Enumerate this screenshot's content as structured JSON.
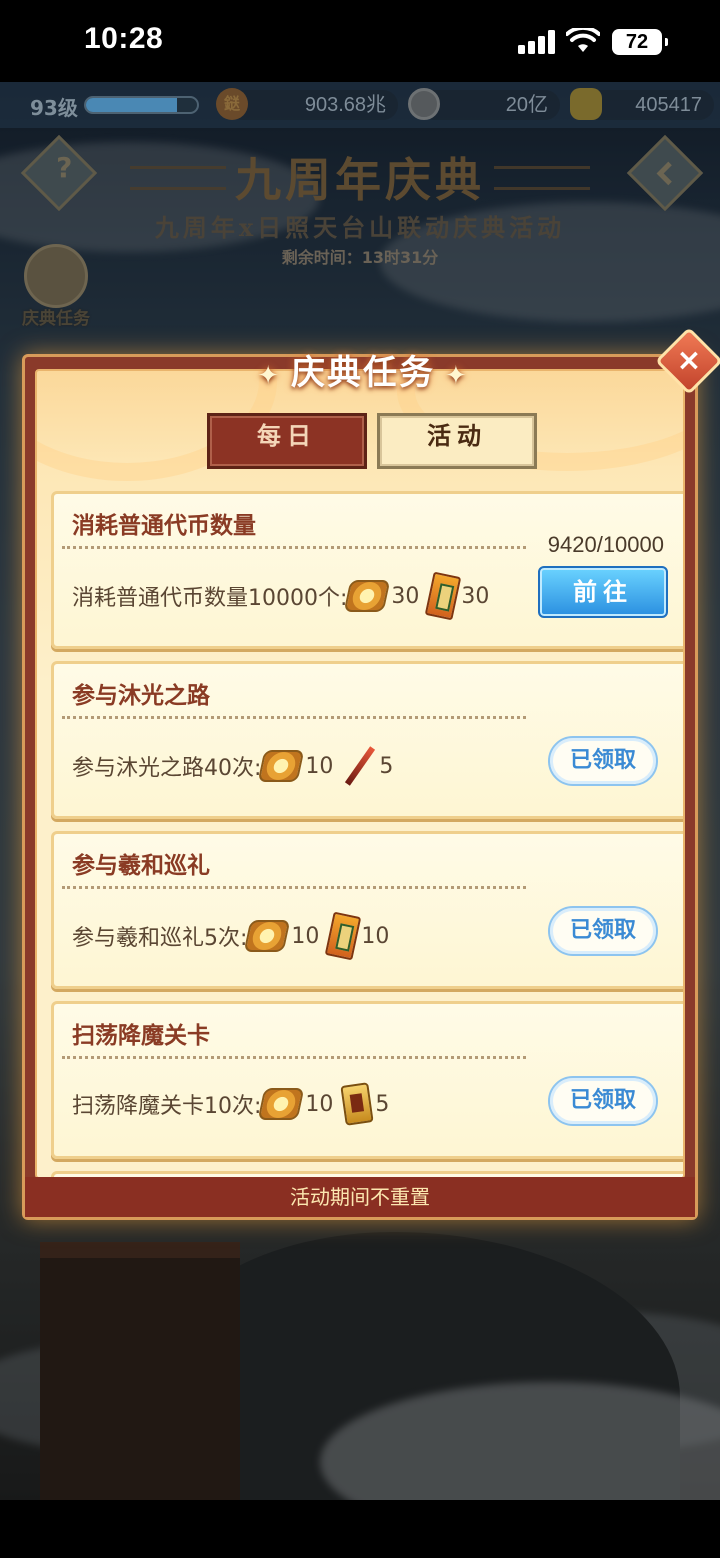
{
  "status_bar": {
    "time": "10:28",
    "battery": "72"
  },
  "hud": {
    "level": "93级",
    "level_progress": 0.82,
    "currency1": "903.68兆",
    "currency2": "20亿",
    "currency3": "405417",
    "currency1_icon_text": "鎹"
  },
  "event": {
    "title": "九周年庆典",
    "subtitle": "九周年x日照天台山联动庆典活动",
    "remaining": "剩余时间：13时31分",
    "help_icon": "?",
    "side_task_label": "庆典任务"
  },
  "modal": {
    "title": "庆典任务",
    "close_icon": "×",
    "tabs": [
      {
        "label": "每日"
      },
      {
        "label": "活动"
      }
    ],
    "tasks": [
      {
        "title": "消耗普通代币数量",
        "desc": "消耗普通代币数量10000个:",
        "reward1": "30",
        "reward2": "30",
        "progress": "9420/10000",
        "action": "前往"
      },
      {
        "title": "参与沐光之路",
        "desc": "参与沐光之路40次:",
        "reward1": "10",
        "reward2": "5",
        "action": "已领取"
      },
      {
        "title": "参与羲和巡礼",
        "desc": "参与羲和巡礼5次:",
        "reward1": "10",
        "reward2": "10",
        "action": "已领取"
      },
      {
        "title": "扫荡降魔关卡",
        "desc": "扫荡降魔关卡10次:",
        "reward1": "10",
        "reward2": "5",
        "action": "已领取"
      }
    ],
    "footer": "活动期间不重置"
  }
}
